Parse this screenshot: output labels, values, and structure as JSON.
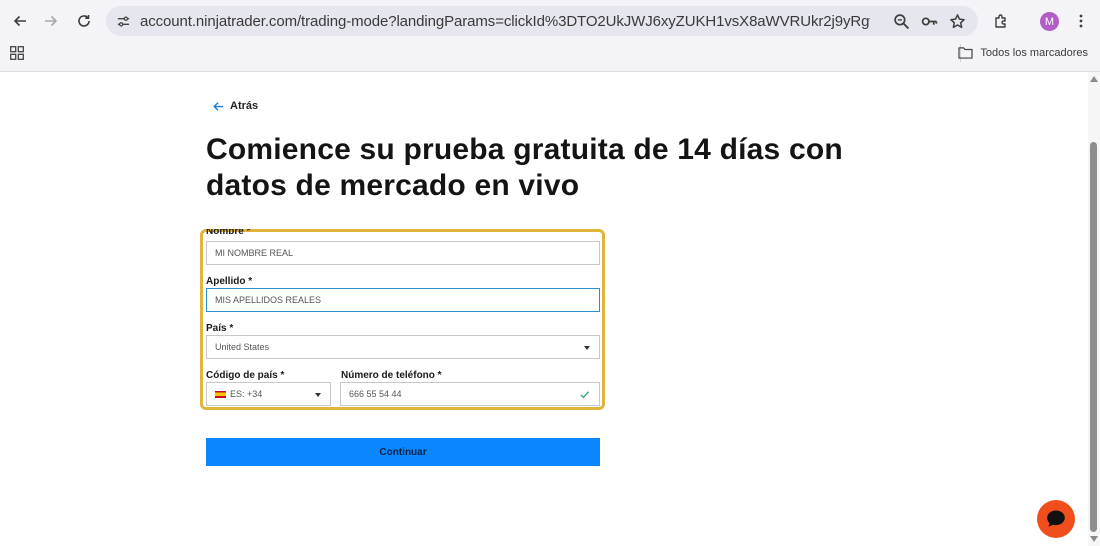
{
  "browser": {
    "url": "account.ninjatrader.com/trading-mode?landingParams=clickId%3DTO2UkJWJ6xyZUKH1vsX8aWVRUkr2j9yRgw%253AJx00%26_gl%3D1...",
    "bookmarks_label": "Todos los marcadores",
    "avatar_letter": "M",
    "avatar_color": "#b35cc8"
  },
  "page": {
    "back_label": "Atrás",
    "title": "Comience su prueba gratuita de 14 días con datos de mercado en vivo"
  },
  "form": {
    "first_name": {
      "label": "Nombre *",
      "value": "MI NOMBRE REAL"
    },
    "last_name": {
      "label": "Apellido *",
      "value": "MIS APELLIDOS REALES"
    },
    "country": {
      "label": "País *",
      "value": "United States"
    },
    "country_code": {
      "label": "Código de país *",
      "value": "ES: +34"
    },
    "phone": {
      "label": "Número de teléfono *",
      "value": "666 55 54 44"
    },
    "highlight_color": "#e1b43b",
    "submit_label": "Continuar",
    "submit_color": "#0a87ff"
  },
  "chat": {
    "icon": "chat-bubble-icon",
    "color": "#f04e1c"
  }
}
